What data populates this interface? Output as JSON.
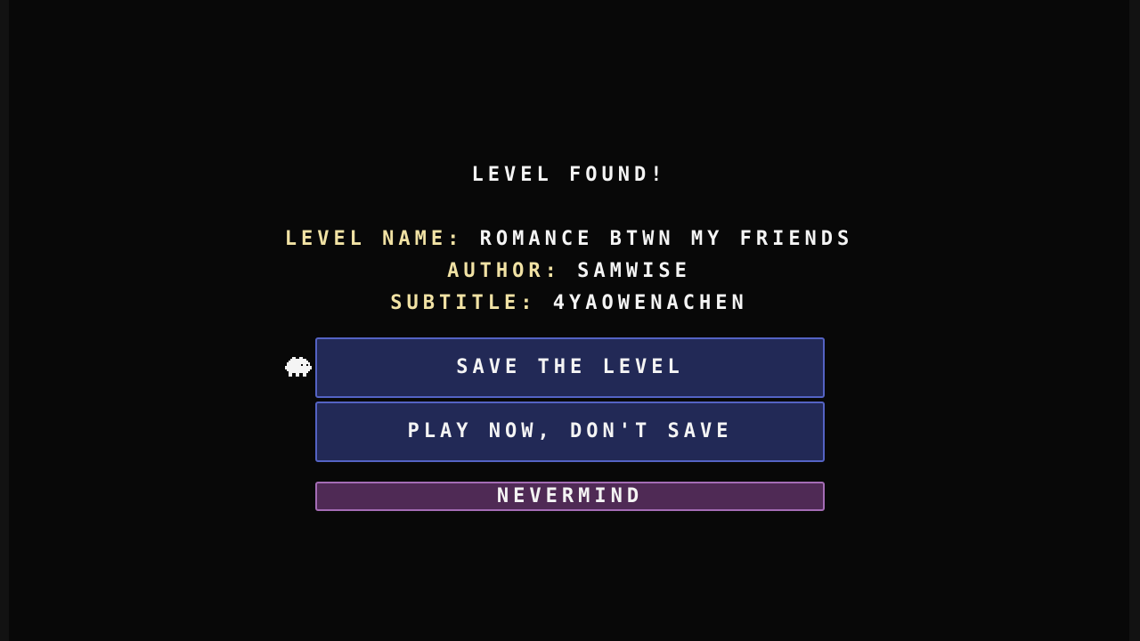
{
  "dialog": {
    "title": "LEVEL FOUND!",
    "name_label": "LEVEL NAME:",
    "name_value": "ROMANCE BTWN MY FRIENDS",
    "author_label": "AUTHOR:",
    "author_value": "SAMWISE",
    "subtitle_label": "SUBTITLE:",
    "subtitle_value": "4YAOWENACHEN"
  },
  "buttons": {
    "save_label": "SAVE THE LEVEL",
    "play_label": "PLAY NOW, DON'T SAVE",
    "nevermind_label": "NEVERMIND"
  },
  "selector": {
    "icon": "cursor-creature-icon",
    "selected": "save"
  },
  "colors": {
    "background": "#080808",
    "label": "#f1e2a4",
    "text": "#f4f4f4",
    "primary_button_fill": "#222956",
    "primary_button_border": "#5463c4",
    "cancel_button_fill": "#4f2a55",
    "cancel_button_border": "#a46cb5"
  }
}
